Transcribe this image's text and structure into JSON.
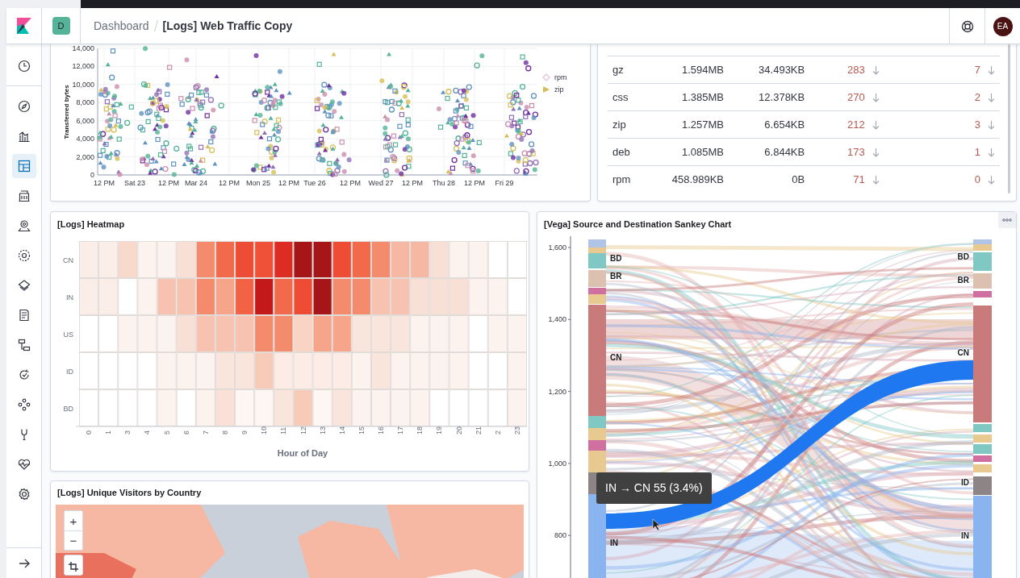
{
  "header": {
    "space_badge": "D",
    "breadcrumbs": [
      {
        "label": "Dashboard",
        "selected": false
      },
      {
        "label": "[Logs] Web Traffic Copy",
        "selected": true
      }
    ],
    "avatar": "EA"
  },
  "sidebar": {
    "items": [
      {
        "selected": false
      },
      {
        "selected": false
      },
      {
        "selected": false
      },
      {
        "selected": true
      },
      {
        "selected": false
      },
      {
        "selected": false
      },
      {
        "selected": false
      },
      {
        "selected": false
      },
      {
        "selected": false
      },
      {
        "selected": false
      },
      {
        "selected": false
      },
      {
        "selected": false
      },
      {
        "selected": false
      },
      {
        "selected": false
      },
      {
        "selected": false
      }
    ]
  },
  "scatter_panel": {
    "ylabel": "Transferred bytes",
    "yticks": [
      "14,000",
      "12,000",
      "10,000",
      "8,000",
      "6,000",
      "4,000",
      "2,000",
      "0"
    ],
    "xticks": [
      "12 PM",
      "Sat 23",
      "12 PM",
      "Mar 24",
      "12 PM",
      "Mon 25",
      "12 PM",
      "Tue 26",
      "12 PM",
      "Wed 27",
      "12 PM",
      "Thu 28",
      "12 PM",
      "Fri 29"
    ],
    "legend": [
      {
        "label": "rpm",
        "kind": "diamond",
        "color": "#e6c5dc"
      },
      {
        "label": "zip",
        "kind": "triangle",
        "color": "#d6bf57"
      }
    ]
  },
  "table": {
    "rows": [
      [
        "gz",
        "1.594MB",
        "34.493KB",
        "283",
        "7"
      ],
      [
        "css",
        "1.385MB",
        "12.378KB",
        "270",
        "2"
      ],
      [
        "zip",
        "1.257MB",
        "6.654KB",
        "212",
        "3"
      ],
      [
        "deb",
        "1.085MB",
        "6.844KB",
        "173",
        "1"
      ],
      [
        "rpm",
        "458.989KB",
        "0B",
        "71",
        "0"
      ]
    ]
  },
  "heatmap": {
    "title": "[Logs] Heatmap",
    "xlabel": "Hour of Day",
    "xticks": [
      "0",
      "1",
      "3",
      "4",
      "5",
      "6",
      "7",
      "8",
      "9",
      "10",
      "11",
      "12",
      "13",
      "14",
      "15",
      "16",
      "17",
      "18",
      "19",
      "20",
      "21",
      "2",
      "23"
    ],
    "rows": [
      {
        "label": "CN",
        "cells": [
          {
            "color": "#fbeee9"
          },
          {
            "color": "#fbeee9"
          },
          {
            "color": "#f8d9cc"
          },
          {
            "color": "#fcf2ee"
          },
          {
            "color": "#fcf3ef"
          },
          {
            "color": "#f9e0d6"
          },
          {
            "color": "#f48b6d"
          },
          {
            "color": "#f26a4c"
          },
          {
            "color": "#ee4d35"
          },
          {
            "color": "#ef5038"
          },
          {
            "color": "#dd2c24"
          },
          {
            "color": "#a61518"
          },
          {
            "color": "#a61518"
          },
          {
            "color": "#ef4c35"
          },
          {
            "color": "#f36a4a"
          },
          {
            "color": "#f48b6d"
          },
          {
            "color": "#f7b8a3"
          },
          {
            "color": "#f7b8a3"
          },
          {
            "color": "#f9e0d6"
          },
          {
            "color": "#fcf3ef"
          },
          {
            "color": "#fcf3ef"
          },
          {
            "color": "#ffffff"
          },
          {
            "color": "#ffffff"
          }
        ]
      },
      {
        "label": "IN",
        "cells": [
          {
            "color": "#fbeee9"
          },
          {
            "color": "#fbeee9"
          },
          {
            "color": "#ffffff"
          },
          {
            "color": "#fcf3ef"
          },
          {
            "color": "#f7c3b0"
          },
          {
            "color": "#f7c3b0"
          },
          {
            "color": "#f48b6d"
          },
          {
            "color": "#f6a58a"
          },
          {
            "color": "#f26346"
          },
          {
            "color": "#c4191b"
          },
          {
            "color": "#f26a4c"
          },
          {
            "color": "#ef4c35"
          },
          {
            "color": "#a61518"
          },
          {
            "color": "#f48b6d"
          },
          {
            "color": "#f48b6d"
          },
          {
            "color": "#f7c3b0"
          },
          {
            "color": "#f7c3b0"
          },
          {
            "color": "#f9e0d6"
          },
          {
            "color": "#f9e0d6"
          },
          {
            "color": "#f9e0d6"
          },
          {
            "color": "#fcf3ef"
          },
          {
            "color": "#fcf3ef"
          },
          {
            "color": "#ffffff"
          }
        ]
      },
      {
        "label": "US",
        "cells": [
          {
            "color": "#ffffff"
          },
          {
            "color": "#ffffff"
          },
          {
            "color": "#fcf3ef"
          },
          {
            "color": "#fcf3ef"
          },
          {
            "color": "#fcf3ef"
          },
          {
            "color": "#f9e0d6"
          },
          {
            "color": "#f7c3b0"
          },
          {
            "color": "#f7c3b0"
          },
          {
            "color": "#f7c3b0"
          },
          {
            "color": "#f48b6d"
          },
          {
            "color": "#f48b6d"
          },
          {
            "color": "#f9d3c3"
          },
          {
            "color": "#f6a58a"
          },
          {
            "color": "#f6a58a"
          },
          {
            "color": "#fae5dc"
          },
          {
            "color": "#fae5dc"
          },
          {
            "color": "#fae5dc"
          },
          {
            "color": "#fcf3ef"
          },
          {
            "color": "#fcf3ef"
          },
          {
            "color": "#fcf3ef"
          },
          {
            "color": "#ffffff"
          },
          {
            "color": "#fcf3ef"
          },
          {
            "color": "#fcf3ef"
          }
        ]
      },
      {
        "label": "ID",
        "cells": [
          {
            "color": "#ffffff"
          },
          {
            "color": "#ffffff"
          },
          {
            "color": "#ffffff"
          },
          {
            "color": "#ffffff"
          },
          {
            "color": "#fcf3ef"
          },
          {
            "color": "#fcf3ef"
          },
          {
            "color": "#fcf3ef"
          },
          {
            "color": "#fae5dc"
          },
          {
            "color": "#fae5dc"
          },
          {
            "color": "#f8cbb8"
          },
          {
            "color": "#fcece5"
          },
          {
            "color": "#fcece5"
          },
          {
            "color": "#fcece5"
          },
          {
            "color": "#fcece5"
          },
          {
            "color": "#fcf3ef"
          },
          {
            "color": "#fae5dc"
          },
          {
            "color": "#fcf3ef"
          },
          {
            "color": "#fcf3ef"
          },
          {
            "color": "#fcf3ef"
          },
          {
            "color": "#fcf3ef"
          },
          {
            "color": "#ffffff"
          },
          {
            "color": "#ffffff"
          },
          {
            "color": "#fcf3ef"
          }
        ]
      },
      {
        "label": "BD",
        "cells": [
          {
            "color": "#ffffff"
          },
          {
            "color": "#ffffff"
          },
          {
            "color": "#ffffff"
          },
          {
            "color": "#ffffff"
          },
          {
            "color": "#fcf3ef"
          },
          {
            "color": "#ffffff"
          },
          {
            "color": "#fcf3ef"
          },
          {
            "color": "#fae0d6"
          },
          {
            "color": "#fdf6f3"
          },
          {
            "color": "#fdf6f3"
          },
          {
            "color": "#fae5dc"
          },
          {
            "color": "#f8cbb8"
          },
          {
            "color": "#fdf6f3"
          },
          {
            "color": "#fae5dc"
          },
          {
            "color": "#fcf3ef"
          },
          {
            "color": "#fcf3ef"
          },
          {
            "color": "#fcf3ef"
          },
          {
            "color": "#fcf3ef"
          },
          {
            "color": "#ffffff"
          },
          {
            "color": "#ffffff"
          },
          {
            "color": "#ffffff"
          },
          {
            "color": "#ffffff"
          },
          {
            "color": "#fcf3ef"
          }
        ]
      }
    ]
  },
  "sankey": {
    "title": "[Vega] Source and Destination Sankey Chart",
    "yticks": [
      "1,600",
      "1,400",
      "1,200",
      "1,000",
      "800"
    ],
    "left_nodes": [
      "BD",
      "BR",
      "CN",
      "IN"
    ],
    "right_nodes": [
      "BD",
      "BR",
      "CN",
      "ID",
      "IN"
    ],
    "tooltip": "IN → CN 55 (3.4%)"
  },
  "map": {
    "title": "[Logs] Unique Visitors by Country",
    "zoom_in": "+",
    "zoom_out": "−"
  }
}
